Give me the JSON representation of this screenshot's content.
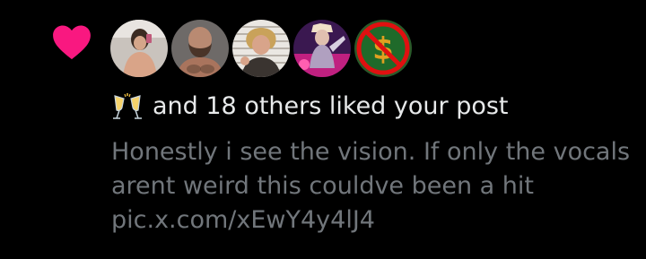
{
  "notification": {
    "type_icon": "heart-icon",
    "accent_color": "#f91880",
    "avatars": [
      {
        "name": "avatar-1"
      },
      {
        "name": "avatar-2"
      },
      {
        "name": "avatar-3"
      },
      {
        "name": "avatar-4"
      },
      {
        "name": "avatar-5"
      }
    ],
    "emoji": "clinking-glasses-emoji",
    "summary_text": "and 18 others liked your post",
    "post_text": "Honestly i see the vision. If only the vocals arent weird this couldve been a hit pic.x.com/xEwY4y4lJ4"
  }
}
